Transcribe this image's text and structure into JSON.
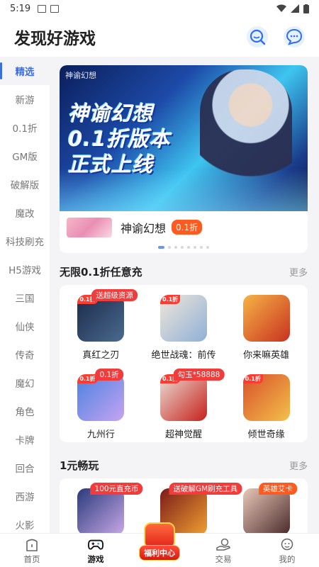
{
  "status": {
    "time": "5:19"
  },
  "header": {
    "title": "发现好游戏",
    "search_icon": "search-icon",
    "message_icon": "message-icon"
  },
  "sidebar": {
    "items": [
      {
        "label": "精选",
        "active": true
      },
      {
        "label": "新游"
      },
      {
        "label": "0.1折"
      },
      {
        "label": "GM版"
      },
      {
        "label": "破解版"
      },
      {
        "label": "魔改"
      },
      {
        "label": "科技刷充"
      },
      {
        "label": "H5游戏"
      },
      {
        "label": "三国"
      },
      {
        "label": "仙侠"
      },
      {
        "label": "传奇"
      },
      {
        "label": "魔幻"
      },
      {
        "label": "角色"
      },
      {
        "label": "卡牌"
      },
      {
        "label": "回合"
      },
      {
        "label": "西游"
      },
      {
        "label": "火影"
      }
    ]
  },
  "banner": {
    "logo": "神谕幻想",
    "headline_line1": "神谕幻想",
    "headline_line2": "0.1折版本",
    "headline_line3": "正式上线",
    "game_name": "神谕幻想",
    "discount": "0.1折",
    "dot_count": 8,
    "active_dot": 0
  },
  "section1": {
    "title": "无限0.1折任意充",
    "more": "更多",
    "games": [
      {
        "name": "真红之刃",
        "badge": "送超级资源",
        "corner": "0.1折",
        "colors": [
          "#1b2a4a",
          "#4a6a8f"
        ]
      },
      {
        "name": "绝世战魂：前传",
        "badge": "",
        "corner": "0.1折",
        "colors": [
          "#f0e6d8",
          "#8fb0d8"
        ]
      },
      {
        "name": "你来嘛英雄",
        "badge": "",
        "corner": "",
        "colors": [
          "#f6b347",
          "#c8321f"
        ]
      },
      {
        "name": "九州行",
        "badge": "0.1折",
        "corner": "0.1折",
        "colors": [
          "#4a82e0",
          "#c7a3f2"
        ]
      },
      {
        "name": "超神觉醒",
        "badge": "勾玉*58888",
        "corner": "0.1折",
        "colors": [
          "#e8e0d8",
          "#c8201a"
        ]
      },
      {
        "name": "倾世奇缘",
        "badge": "",
        "corner": "0.1折",
        "colors": [
          "#d8502a",
          "#f4c04a"
        ]
      }
    ]
  },
  "section2": {
    "title": "1元畅玩",
    "more": "更多",
    "games": [
      {
        "name": "",
        "badge": "100元直充币",
        "colors": [
          "#2a3a7a",
          "#c8a8e8"
        ]
      },
      {
        "name": "",
        "badge": "送破解GM刷充工具",
        "colors": [
          "#7a1a1a",
          "#f0a030"
        ]
      },
      {
        "name": "",
        "badge": "英雄艾卡",
        "colors": [
          "#e8c8b8",
          "#4a2a2a"
        ]
      }
    ]
  },
  "tabbar": {
    "tabs": [
      {
        "label": "首页",
        "icon": "home-icon"
      },
      {
        "label": "游戏",
        "icon": "gamepad-icon",
        "active": true
      },
      {
        "label": "福利中心",
        "icon": "gift-bag-icon"
      },
      {
        "label": "交易",
        "icon": "trade-icon"
      },
      {
        "label": "我的",
        "icon": "profile-icon"
      }
    ]
  }
}
